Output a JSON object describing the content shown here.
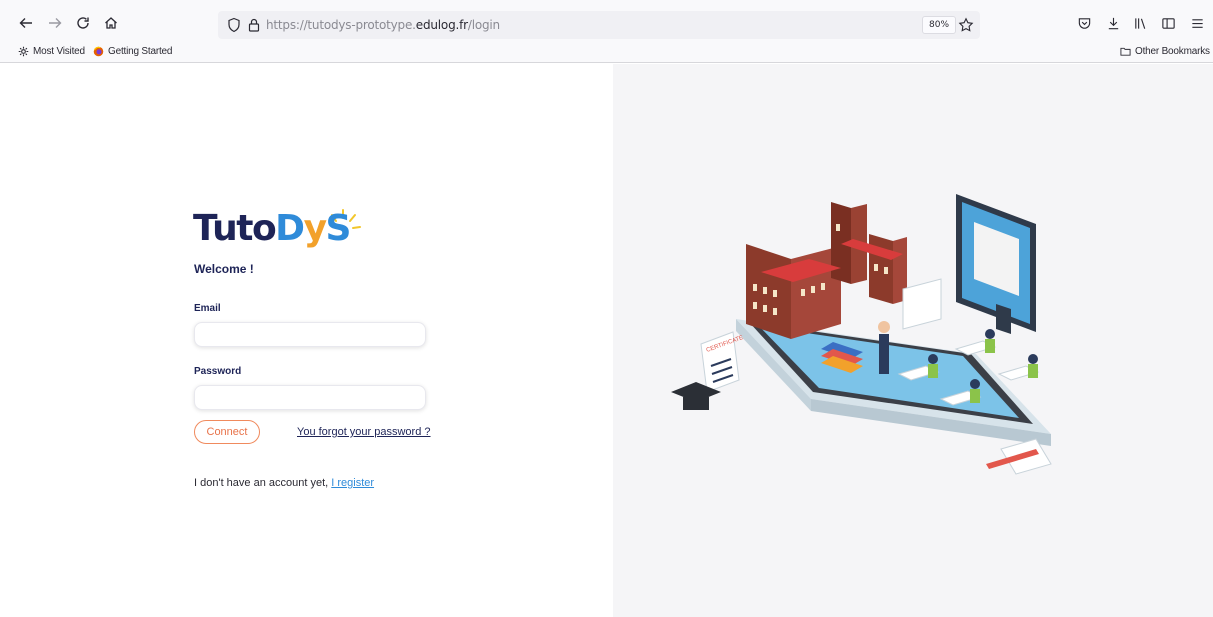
{
  "browser": {
    "url_prefix": "https://tutodys-prototype.",
    "url_host": "edulog.fr",
    "url_path": "/login",
    "zoom": "80%"
  },
  "bookmarks": {
    "most_visited": "Most Visited",
    "getting_started": "Getting Started",
    "other_bookmarks": "Other Bookmarks"
  },
  "login": {
    "logo_tuto": "Tuto",
    "logo_d": "D",
    "logo_y": "y",
    "logo_s": "S",
    "welcome": "Welcome !",
    "email_label": "Email",
    "email_value": "",
    "password_label": "Password",
    "password_value": "",
    "connect_label": "Connect",
    "forgot_label": "You forgot your password ?",
    "no_account_text": "I don't have an account yet, ",
    "register_label": "I register"
  },
  "illustration": {
    "certificate_label": "CERTIFICATE"
  },
  "colors": {
    "brand_navy": "#1e2457",
    "brand_blue": "#2f8bd9",
    "brand_orange": "#e8734a",
    "brand_yellow": "#f2a12b"
  }
}
